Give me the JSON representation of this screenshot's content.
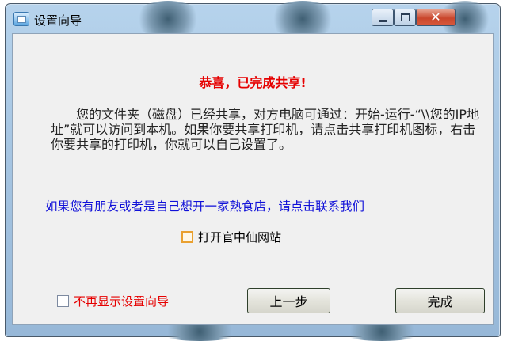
{
  "window": {
    "title": "设置向导"
  },
  "main": {
    "heading": "恭喜，已完成共享!",
    "paragraph": "您的文件夹（磁盘）已经共享，对方电脑可通过：开始-运行-“\\\\您的IP地址”就可以访问到本机。如果你要共享打印机，请点击共享打印机图标，右击你要共享的打印机，你就可以自己设置了。",
    "contact_text": "如果您有朋友或者是自己想开一家熟食店，请点击联系我们",
    "open_official_site": {
      "label": "打开官中仙网站",
      "checked": false
    },
    "dont_show_again": {
      "label": "不再显示设置向导",
      "checked": false
    }
  },
  "buttons": {
    "prev": "上一步",
    "finish": "完成"
  },
  "colors": {
    "accent_red": "#e60000",
    "link_blue": "#1010d8"
  }
}
